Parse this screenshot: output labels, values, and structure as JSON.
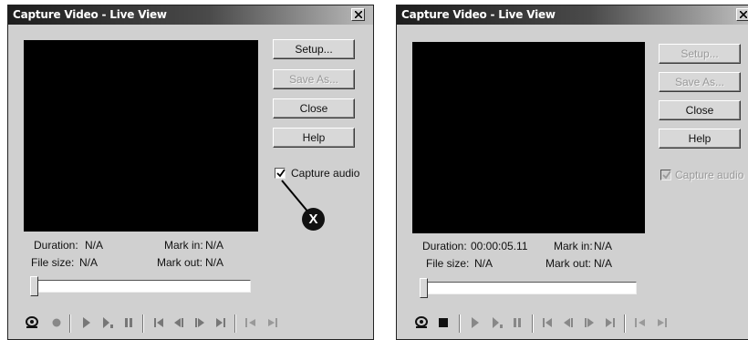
{
  "left_window": {
    "title": "Capture Video - Live View",
    "buttons": {
      "setup": "Setup...",
      "save_as": "Save As...",
      "close": "Close",
      "help": "Help"
    },
    "capture_audio": {
      "label": "Capture audio",
      "checked": true,
      "enabled": true
    },
    "info": {
      "duration_label": "Duration:",
      "duration_value": "N/A",
      "file_size_label": "File size:",
      "file_size_value": "N/A",
      "mark_in_label": "Mark in:",
      "mark_in_value": "N/A",
      "mark_out_label": "Mark out:",
      "mark_out_value": "N/A"
    },
    "callout": "X"
  },
  "right_window": {
    "title": "Capture Video - Live View",
    "buttons": {
      "setup": "Setup...",
      "save_as": "Save As...",
      "close": "Close",
      "help": "Help"
    },
    "capture_audio": {
      "label": "Capture audio",
      "checked": true,
      "enabled": false
    },
    "info": {
      "duration_label": "Duration:",
      "duration_value": "00:00:05.11",
      "file_size_label": "File size:",
      "file_size_value": "N/A",
      "mark_in_label": "Mark in:",
      "mark_in_value": "N/A",
      "mark_out_label": "Mark out:",
      "mark_out_value": "N/A"
    }
  },
  "controls": [
    "preview-icon",
    "record-icon",
    "play-icon",
    "play-slow-icon",
    "pause-icon",
    "go-to-start-icon",
    "step-back-icon",
    "step-forward-icon",
    "go-to-end-icon",
    "mark-in-icon",
    "mark-out-icon"
  ],
  "colors": {
    "window_bg": "#d0d0d0",
    "titlebar_dark": "#1e1e1e",
    "preview_bg": "#000000",
    "disabled_text": "#999999"
  }
}
